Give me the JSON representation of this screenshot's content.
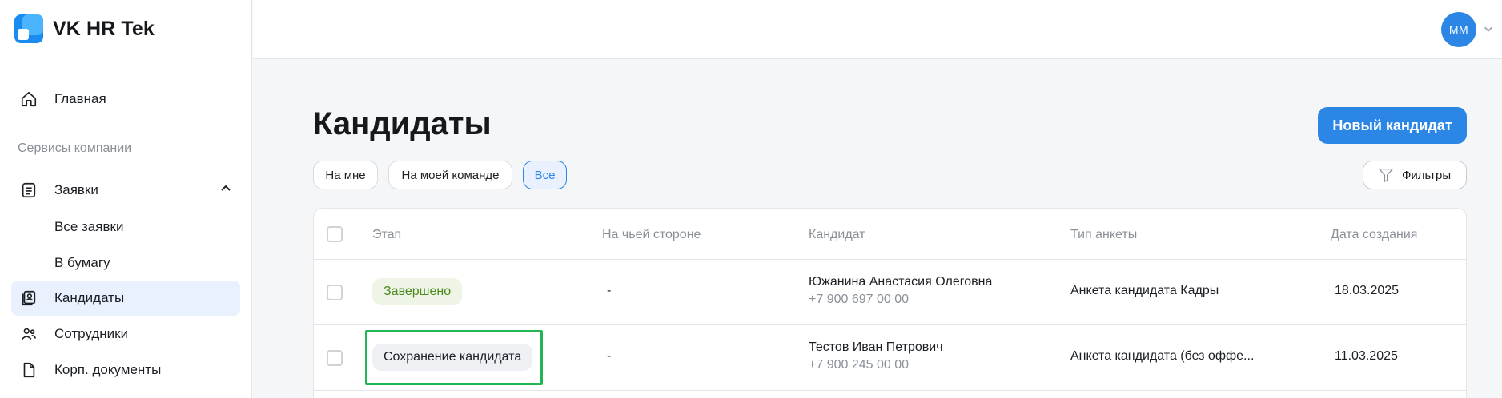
{
  "app": {
    "name": "VK HR Tek"
  },
  "sidebar": {
    "home_label": "Главная",
    "section_label": "Сервисы компании",
    "requests_label": "Заявки",
    "requests_sub": [
      "Все заявки",
      "В бумагу"
    ],
    "candidates_label": "Кандидаты",
    "employees_label": "Сотрудники",
    "docs_label": "Корп. документы"
  },
  "header": {
    "avatar_initials": "ММ"
  },
  "main": {
    "title": "Кандидаты",
    "new_button": "Новый кандидат",
    "filter_chips": [
      "На мне",
      "На моей команде",
      "Все"
    ],
    "selected_chip": "Все",
    "filters_button": "Фильтры"
  },
  "table": {
    "columns": [
      "Этап",
      "На чьей стороне",
      "Кандидат",
      "Тип анкеты",
      "Дата создания"
    ],
    "rows": [
      {
        "stage": "Завершено",
        "side": "-",
        "name": "Южанина Анастасия Олеговна",
        "phone": "+7 900 697 00 00",
        "form_type": "Анкета кандидата Кадры",
        "created": "18.03.2025"
      },
      {
        "stage": "Сохранение кандидата",
        "side": "-",
        "name": "Тестов Иван Петрович",
        "phone": "+7 900 245 00 00",
        "form_type": "Анкета кандидата (без оффе...",
        "created": "11.03.2025"
      }
    ]
  },
  "colors": {
    "accent": "#2b86e6",
    "active_nav_bg": "#eaf1fe",
    "done_badge_text": "#4c8a1e",
    "highlight_border": "#22b554"
  }
}
